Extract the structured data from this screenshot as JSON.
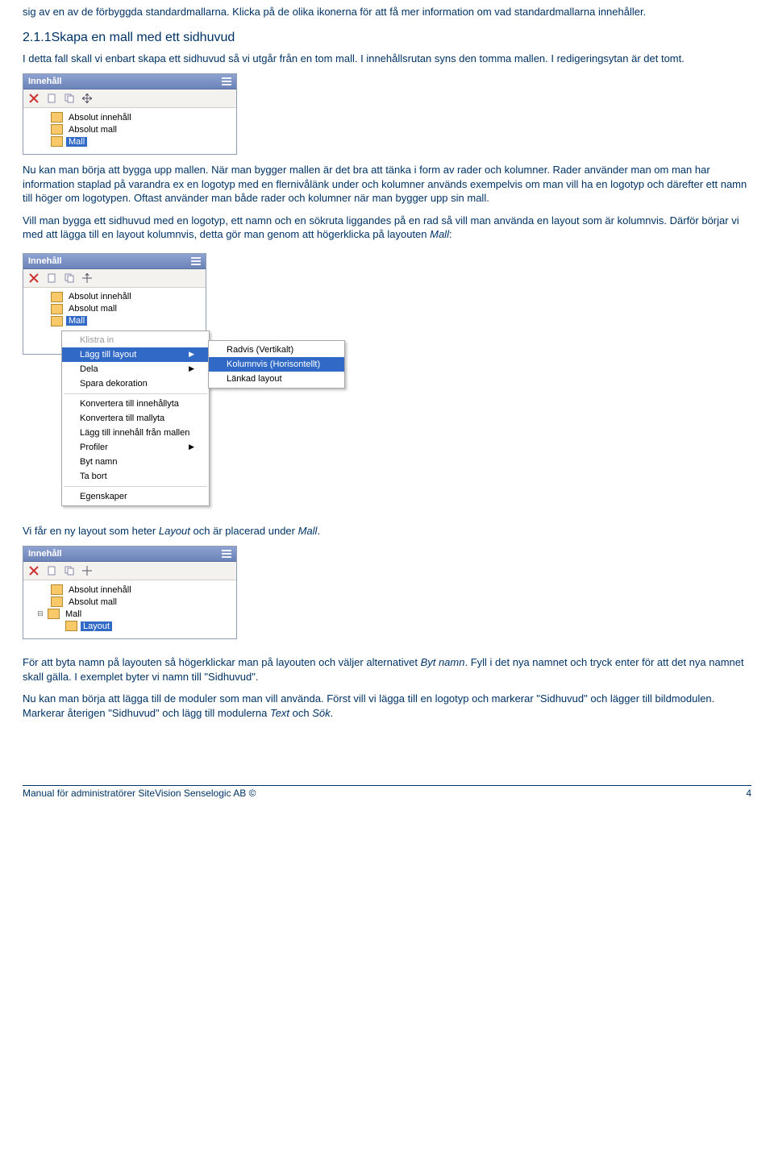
{
  "intro": "sig av en av de förbyggda standardmallarna. Klicka på de olika ikonerna för att få mer information om vad standardmallarna innehåller.",
  "section_heading": "2.1.1Skapa en mall med ett sidhuvud",
  "intro2": "I detta fall skall vi enbart skapa ett sidhuvud så vi utgår från en tom mall. I innehållsrutan syns den tomma mallen. I redigeringsytan är det tomt.",
  "panel": {
    "title": "Innehåll",
    "items": [
      "Absolut innehåll",
      "Absolut mall",
      "Mall"
    ]
  },
  "para1": "Nu kan man börja att bygga upp mallen. När man bygger mallen är det bra att tänka i form av rader och kolumner. Rader använder man om man har information staplad på varandra ex en logotyp med en flernivålänk under och kolumner används exempelvis om man vill ha en logotyp och därefter ett namn till höger om logotypen. Oftast använder man både rader och kolumner när man bygger upp sin mall.",
  "para2a": "Vill man bygga ett sidhuvud med en logotyp, ett namn och en sökruta liggandes på en rad så vill man använda en layout som är kolumnvis. Därför börjar vi med att lägga till en layout kolumnvis, detta gör man genom att högerklicka på layouten ",
  "para2b": "Mall",
  "para2c": ":",
  "ctx": {
    "title": "Innehåll",
    "tree": [
      "Absolut innehåll",
      "Absolut mall",
      "Mall"
    ],
    "items": [
      {
        "label": "Klistra in",
        "disabled": true
      },
      {
        "label": "Lägg till layout",
        "arrow": true,
        "sel": true
      },
      {
        "label": "Dela",
        "arrow": true
      },
      {
        "label": "Spara dekoration"
      },
      {
        "sep": true
      },
      {
        "label": "Konvertera till innehållyta"
      },
      {
        "label": "Konvertera till mallyta"
      },
      {
        "label": "Lägg till innehåll från mallen"
      },
      {
        "label": "Profiler",
        "arrow": true
      },
      {
        "label": "Byt namn"
      },
      {
        "label": "Ta bort"
      },
      {
        "sep": true
      },
      {
        "label": "Egenskaper"
      }
    ],
    "sub": [
      {
        "label": "Radvis (Vertikalt)"
      },
      {
        "label": "Kolumnvis (Horisontellt)",
        "sel": true
      },
      {
        "label": "Länkad layout"
      }
    ]
  },
  "para3a": "Vi får en ny layout som heter ",
  "para3b": "Layout",
  "para3c": " och är placerad under ",
  "para3d": "Mall",
  "para3e": ".",
  "panel3": {
    "title": "Innehåll",
    "items": [
      "Absolut innehåll",
      "Absolut mall",
      "Mall",
      "Layout"
    ]
  },
  "para4a": "För att byta namn på layouten så högerklickar man på layouten och väljer alternativet ",
  "para4b": "Byt namn",
  "para4c": ". Fyll i det nya namnet och tryck enter för att det nya namnet skall gälla. I exemplet byter vi namn till \"Sidhuvud\".",
  "para5a": "Nu kan man börja att lägga till de moduler som man vill använda. Först vill vi lägga till en logotyp och markerar \"Sidhuvud\" och lägger till bildmodulen. Markerar återigen \"Sidhuvud\" och lägg till modulerna ",
  "para5b": "Text",
  "para5c": " och ",
  "para5d": "Sök",
  "para5e": ".",
  "footer": {
    "left": "Manual för administratörer SiteVision Senselogic AB ©",
    "right": "4"
  }
}
